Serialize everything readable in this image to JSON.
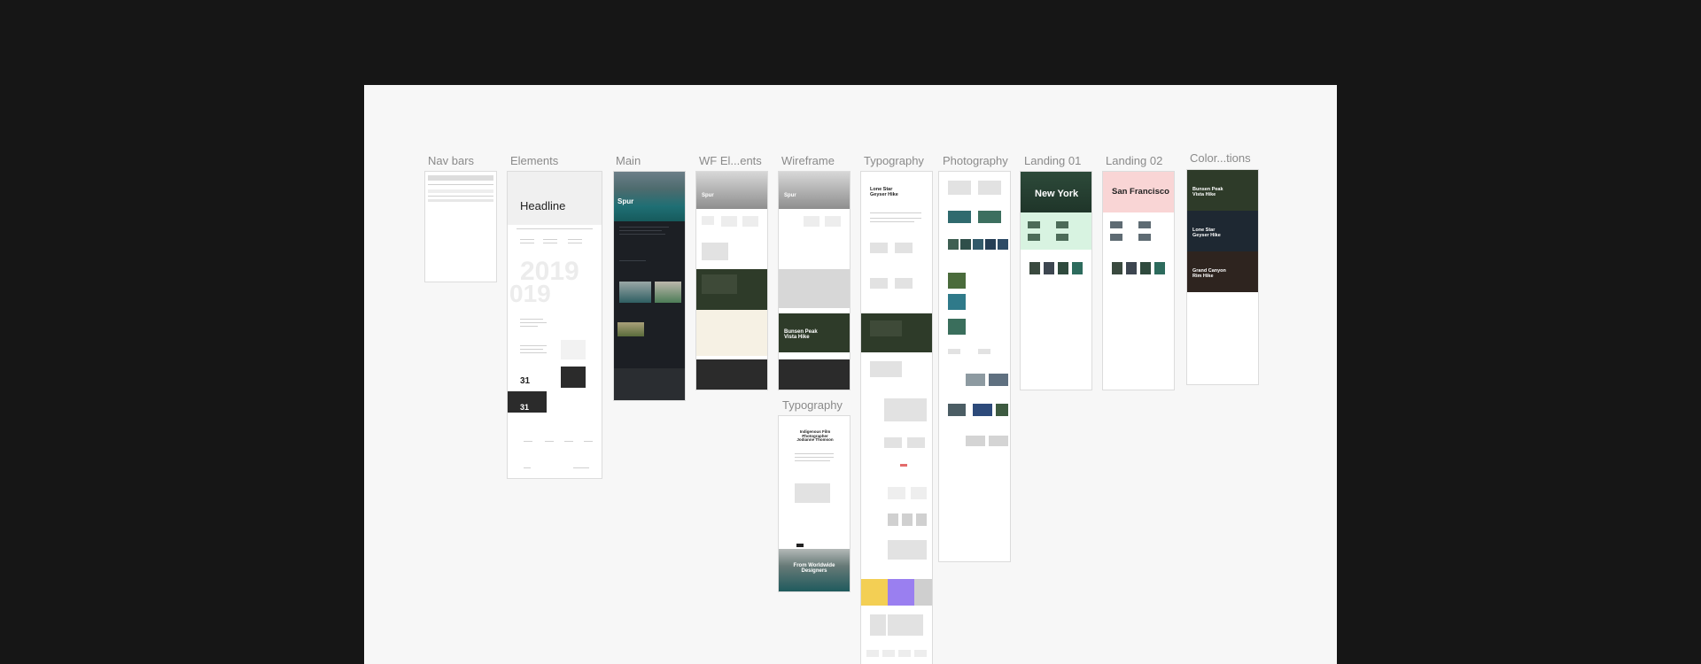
{
  "frames": [
    {
      "id": "nav-bars",
      "label": "Nav bars"
    },
    {
      "id": "elements",
      "label": "Elements",
      "headline": "Headline",
      "year": "2019",
      "year_short": "019",
      "num": "31"
    },
    {
      "id": "main",
      "label": "Main",
      "logo": "Spur"
    },
    {
      "id": "wf-elements",
      "label": "WF El...ents",
      "logo": "Spur"
    },
    {
      "id": "wireframe",
      "label": "Wireframe",
      "logo": "Spur",
      "hero": "Bunsen Peak Vista Hike"
    },
    {
      "id": "typography-small",
      "label": "Typography",
      "title": "Indigenous Film Photographer Jodianne Thomson",
      "banner": "From Worldwide Designers"
    },
    {
      "id": "typography",
      "label": "Typography",
      "title": "Lone Star Geyser Hike"
    },
    {
      "id": "photography",
      "label": "Photography"
    },
    {
      "id": "landing-01",
      "label": "Landing 01",
      "hero": "New York"
    },
    {
      "id": "landing-02",
      "label": "Landing 02",
      "hero": "San Francisco"
    },
    {
      "id": "color-variations",
      "label": "Color...tions",
      "items": [
        "Bunsen Peak Vista Hike",
        "Lone Star Geyser Hike",
        "Grand Canyon Rim Hike"
      ]
    }
  ],
  "colors": {
    "background": "#161616",
    "canvas": "#f7f7f7",
    "dark_green": "#2e3b29",
    "navy": "#1e2832",
    "brown": "#2e241f",
    "pink": "#f9d5d5",
    "mint": "#d8f3e1",
    "cream": "#f6f1e4",
    "yellow": "#f3cf54",
    "purple": "#9a7ff0"
  }
}
